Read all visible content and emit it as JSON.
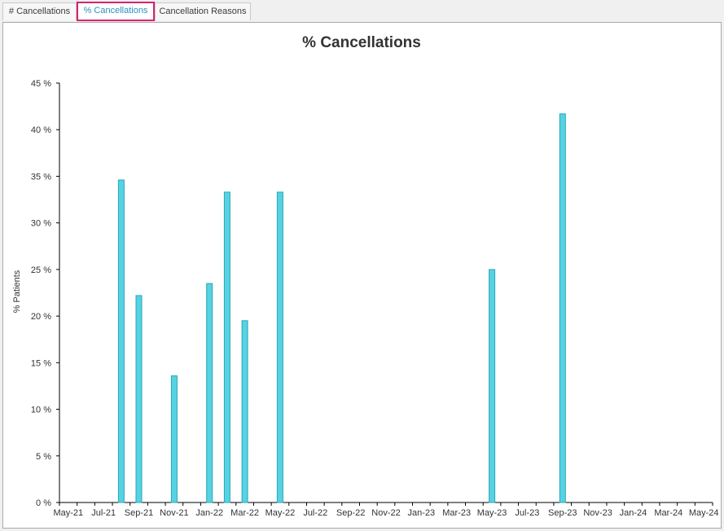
{
  "tabs": [
    {
      "label": "# Cancellations",
      "active": false
    },
    {
      "label": "% Cancellations",
      "active": true
    },
    {
      "label": "Cancellation Reasons",
      "active": false
    }
  ],
  "colors": {
    "bar_fill": "#56d3e3",
    "bar_stroke": "#2aa6b8",
    "active_tab_border": "#d6246e",
    "active_tab_text": "#2a8fbf"
  },
  "chart_data": {
    "type": "bar",
    "title": "% Cancellations",
    "xlabel": "",
    "ylabel": "% Patients",
    "ylim": [
      0,
      45
    ],
    "yticks": [
      "0 %",
      "5 %",
      "10 %",
      "15 %",
      "20 %",
      "25 %",
      "30 %",
      "35 %",
      "40 %",
      "45 %"
    ],
    "ytick_values": [
      0,
      5,
      10,
      15,
      20,
      25,
      30,
      35,
      40,
      45
    ],
    "categories": [
      "May-21",
      "Jun-21",
      "Jul-21",
      "Aug-21",
      "Sep-21",
      "Oct-21",
      "Nov-21",
      "Dec-21",
      "Jan-22",
      "Feb-22",
      "Mar-22",
      "Apr-22",
      "May-22",
      "Jun-22",
      "Jul-22",
      "Aug-22",
      "Sep-22",
      "Oct-22",
      "Nov-22",
      "Dec-22",
      "Jan-23",
      "Feb-23",
      "Mar-23",
      "Apr-23",
      "May-23",
      "Jun-23",
      "Jul-23",
      "Aug-23",
      "Sep-23",
      "Oct-23",
      "Nov-23",
      "Dec-23",
      "Jan-24",
      "Feb-24",
      "Mar-24",
      "Apr-24",
      "May-24"
    ],
    "xtick_labels": [
      "May-21",
      "Jul-21",
      "Sep-21",
      "Nov-21",
      "Jan-22",
      "Mar-22",
      "May-22",
      "Jul-22",
      "Sep-22",
      "Nov-22",
      "Jan-23",
      "Mar-23",
      "May-23",
      "Jul-23",
      "Sep-23",
      "Nov-23",
      "Jan-24",
      "Mar-24",
      "May-24"
    ],
    "values": [
      0,
      0,
      0,
      34.6,
      22.2,
      0,
      13.6,
      0,
      23.5,
      33.3,
      19.5,
      0,
      33.3,
      0,
      0,
      0,
      0,
      0,
      0,
      0,
      0,
      0,
      0,
      0,
      25.0,
      0,
      0,
      0,
      41.7,
      0,
      0,
      0,
      0,
      0,
      0,
      0,
      0
    ],
    "grid": false,
    "legend": "none"
  }
}
